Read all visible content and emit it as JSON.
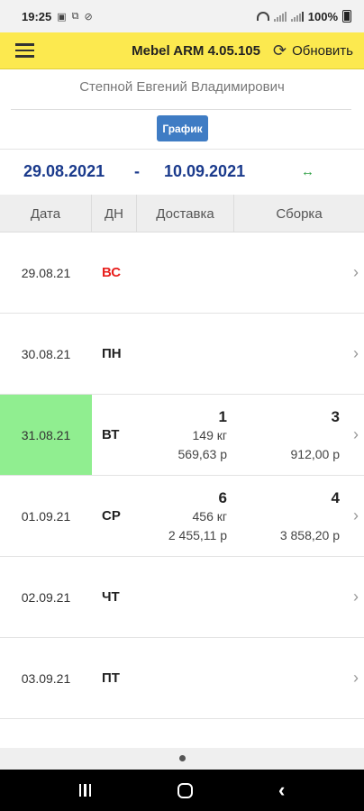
{
  "status_bar": {
    "time": "19:25",
    "battery": "100%",
    "icons": [
      "gallery-icon",
      "screenshot-icon",
      "sync-icon",
      "wifi-icon",
      "signal-icon",
      "battery-icon"
    ]
  },
  "toolbar": {
    "title": "Mebel ARM  4.05.105",
    "refresh_label": "Обновить",
    "background": "#fce94f"
  },
  "user": {
    "name": "Степной Евгений Владимирович"
  },
  "graph_button": {
    "label": "График",
    "color": "#3f7cc4"
  },
  "period": {
    "from": "29.08.2021",
    "separator": "-",
    "to": "10.09.2021",
    "expand_icon": "↔"
  },
  "table": {
    "headers": [
      "Дата",
      "ДН",
      "Доставка",
      "Сборка"
    ],
    "rows": [
      {
        "date": "29.08.21",
        "day": "ВС",
        "weekend": true,
        "today": false,
        "delivery_count": "",
        "delivery_weight": "",
        "delivery_sum": "",
        "assembly_count": "",
        "assembly_sum": ""
      },
      {
        "date": "30.08.21",
        "day": "ПН",
        "weekend": false,
        "today": false,
        "delivery_count": "",
        "delivery_weight": "",
        "delivery_sum": "",
        "assembly_count": "",
        "assembly_sum": ""
      },
      {
        "date": "31.08.21",
        "day": "ВТ",
        "weekend": false,
        "today": true,
        "delivery_count": "1",
        "delivery_weight": "149 кг",
        "delivery_sum": "569,63 р",
        "assembly_count": "3",
        "assembly_sum": "912,00 р"
      },
      {
        "date": "01.09.21",
        "day": "СР",
        "weekend": false,
        "today": false,
        "delivery_count": "6",
        "delivery_weight": "456 кг",
        "delivery_sum": "2 455,11 р",
        "assembly_count": "4",
        "assembly_sum": "3 858,20 р"
      },
      {
        "date": "02.09.21",
        "day": "ЧТ",
        "weekend": false,
        "today": false,
        "delivery_count": "",
        "delivery_weight": "",
        "delivery_sum": "",
        "assembly_count": "",
        "assembly_sum": ""
      },
      {
        "date": "03.09.21",
        "day": "ПТ",
        "weekend": false,
        "today": false,
        "delivery_count": "",
        "delivery_weight": "",
        "delivery_sum": "",
        "assembly_count": "",
        "assembly_sum": ""
      }
    ],
    "today_color": "#90ee90",
    "weekend_color": "#e8201e"
  }
}
